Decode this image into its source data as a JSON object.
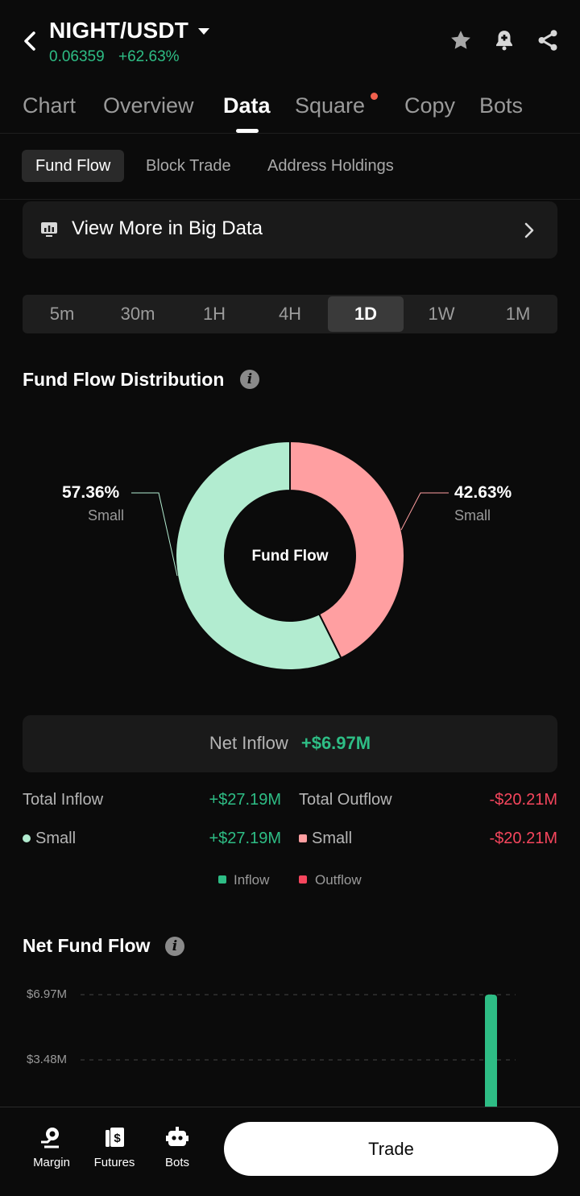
{
  "header": {
    "pair": "NIGHT/USDT",
    "price": "0.06359",
    "change": "+62.63%"
  },
  "main_tabs": [
    {
      "label": "Chart"
    },
    {
      "label": "Overview"
    },
    {
      "label": "Data",
      "active": true
    },
    {
      "label": "Square",
      "has_dot": true
    },
    {
      "label": "Copy"
    },
    {
      "label": "Bots"
    }
  ],
  "sub_tabs": [
    {
      "label": "Fund Flow",
      "active": true
    },
    {
      "label": "Block Trade"
    },
    {
      "label": "Address Holdings"
    }
  ],
  "banner": {
    "label": "View More in Big Data"
  },
  "time_ranges": [
    {
      "label": "5m"
    },
    {
      "label": "30m"
    },
    {
      "label": "1H"
    },
    {
      "label": "4H"
    },
    {
      "label": "1D",
      "active": true
    },
    {
      "label": "1W"
    },
    {
      "label": "1M"
    }
  ],
  "distribution": {
    "title": "Fund Flow Distribution",
    "center_label": "Fund Flow",
    "left_pct": "57.36%",
    "left_sub": "Small",
    "right_pct": "42.63%",
    "right_sub": "Small"
  },
  "net_inflow": {
    "label": "Net Inflow",
    "value": "+$6.97M"
  },
  "totals": {
    "total_inflow_label": "Total Inflow",
    "total_inflow_value": "+$27.19M",
    "total_outflow_label": "Total Outflow",
    "total_outflow_value": "-$20.21M",
    "small_in_label": "Small",
    "small_in_value": "+$27.19M",
    "small_out_label": "Small",
    "small_out_value": "-$20.21M"
  },
  "legend": {
    "inflow": "Inflow",
    "outflow": "Outflow"
  },
  "net_fund_flow": {
    "title": "Net Fund Flow",
    "tick_top": "$6.97M",
    "tick_mid": "$3.48M"
  },
  "chart_data": [
    {
      "type": "pie",
      "labels": [
        "Small",
        "Small"
      ],
      "values": [
        57.36,
        42.63
      ],
      "center_label": "Fund Flow",
      "colors": [
        "#b2ecd0",
        "#ff9fa1"
      ]
    },
    {
      "type": "bar",
      "title": "Net Fund Flow",
      "y_ticks": [
        "$6.97M",
        "$3.48M"
      ],
      "values": [
        6.97
      ],
      "ylim": [
        0,
        6.97
      ],
      "color": "#2ebd85"
    }
  ],
  "bottom_nav": [
    {
      "label": "Margin",
      "icon": "margin-icon"
    },
    {
      "label": "Futures",
      "icon": "futures-icon"
    },
    {
      "label": "Bots",
      "icon": "bots-icon"
    }
  ],
  "trade_button": {
    "label": "Trade"
  },
  "colors": {
    "green": "#2ebd85",
    "red": "#f6465d",
    "inflow_slice": "#b2ecd0",
    "outflow_slice": "#ff9fa1"
  }
}
